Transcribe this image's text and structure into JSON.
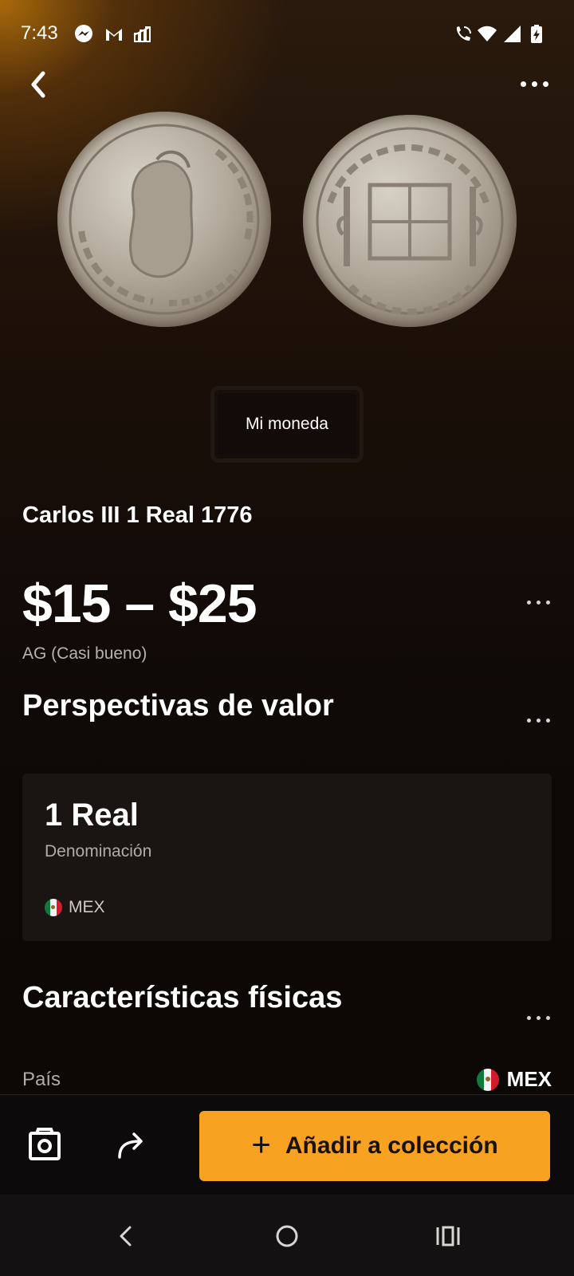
{
  "status_bar": {
    "time": "7:43",
    "icons": [
      "messenger-icon",
      "gmail-icon",
      "notification-app-icon",
      "wifi-calling-icon",
      "wifi-icon",
      "signal-icon",
      "battery-charging-icon"
    ]
  },
  "top_bar": {
    "back_icon": "chevron-left-icon",
    "more_icon": "more-horizontal-icon"
  },
  "images": {
    "obverse": "coin-obverse-photo",
    "reverse": "coin-reverse-photo"
  },
  "badge": {
    "label": "Mi moneda"
  },
  "coin": {
    "title": "Carlos III 1 Real 1776",
    "price_range": "$15 – $25",
    "grade": "AG (Casi bueno)"
  },
  "value_section": {
    "title": "Perspectivas de valor",
    "card": {
      "value": "1 Real",
      "label": "Denominación",
      "country": "MEX"
    }
  },
  "physical_section": {
    "title": "Características físicas",
    "rows": [
      {
        "label": "País",
        "value": "MEX"
      }
    ]
  },
  "actions": {
    "add_label": "Añadir a colección",
    "photo_icon": "camera-icon",
    "share_icon": "share-icon"
  },
  "colors": {
    "accent": "#f7a220",
    "background": "#0b0706",
    "card": "#1a1412"
  }
}
